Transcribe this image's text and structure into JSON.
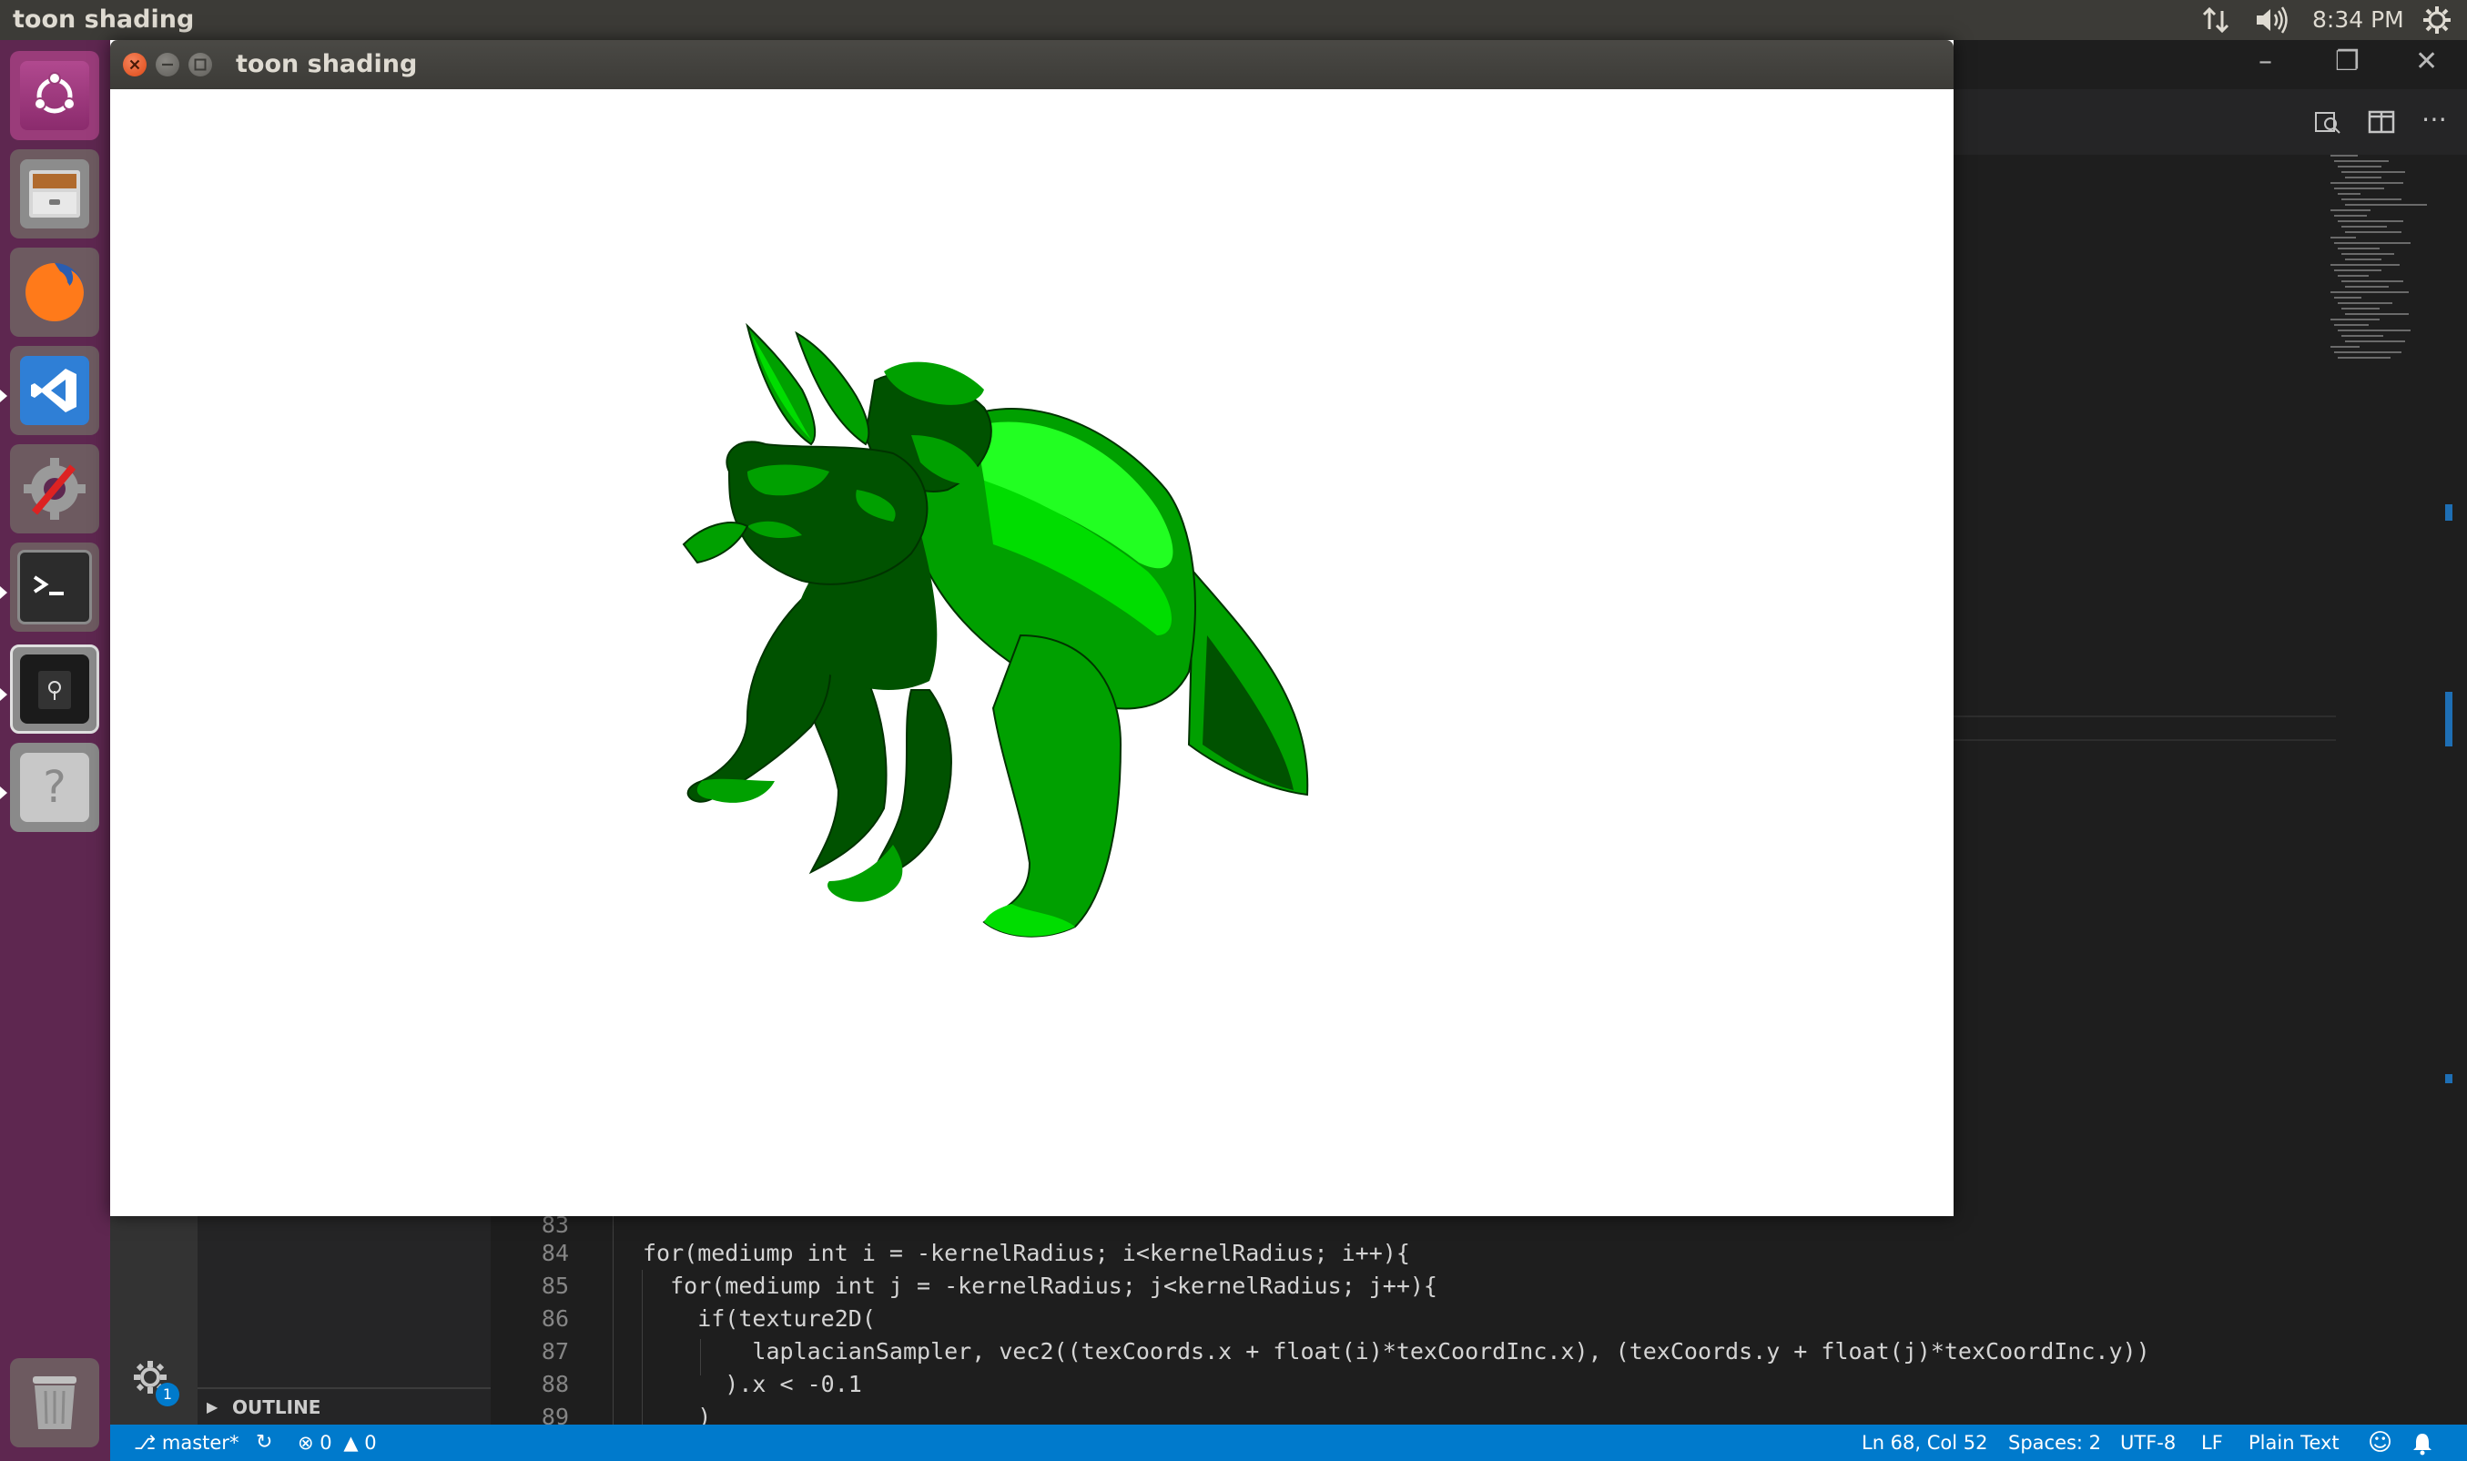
{
  "top_panel": {
    "title": "toon shading",
    "clock": "8:34 PM",
    "icons": [
      "network-icon",
      "volume-icon",
      "settings-icon"
    ]
  },
  "launcher": {
    "items": [
      {
        "name": "ubuntu-logo",
        "active": false
      },
      {
        "name": "files-app",
        "active": false
      },
      {
        "name": "firefox-app",
        "active": false
      },
      {
        "name": "vscode-app",
        "active": true
      },
      {
        "name": "system-settings-app",
        "active": false
      },
      {
        "name": "terminal-app",
        "active": true
      },
      {
        "name": "toon-shading-app",
        "active": true
      },
      {
        "name": "unknown-app",
        "active": true
      },
      {
        "name": "trash",
        "active": false
      }
    ]
  },
  "toon_window": {
    "title": "toon shading",
    "model_colors": {
      "dark": "#005200",
      "mid": "#00a000",
      "light": "#00dd00",
      "bright": "#22ff22"
    }
  },
  "editor": {
    "line_numbers": [
      "83",
      "84",
      "85",
      "86",
      "87",
      "88",
      "89"
    ],
    "lines": [
      "",
      "for(mediump int i = -kernelRadius; i<kernelRadius; i++){",
      "  for(mediump int j = -kernelRadius; j<kernelRadius; j++){",
      "    if(texture2D(",
      "        laplacianSampler, vec2((texCoords.x + float(i)*texCoordInc.x), (texCoords.y + float(j)*texCoordInc.y))",
      "      ).x < -0.1",
      "    )"
    ]
  },
  "sidebar": {
    "outline_label": "OUTLINE",
    "settings_badge": "1"
  },
  "statusbar": {
    "branch": "master*",
    "errors": "0",
    "warnings": "0",
    "position": "Ln 68, Col 52",
    "spaces": "Spaces: 2",
    "encoding": "UTF-8",
    "eol": "LF",
    "language": "Plain Text"
  },
  "colors": {
    "launcher_bg": "#5e2750",
    "statusbar_bg": "#007acc",
    "editor_bg": "#1e1e1e",
    "panel_bg": "#3c3b37"
  }
}
